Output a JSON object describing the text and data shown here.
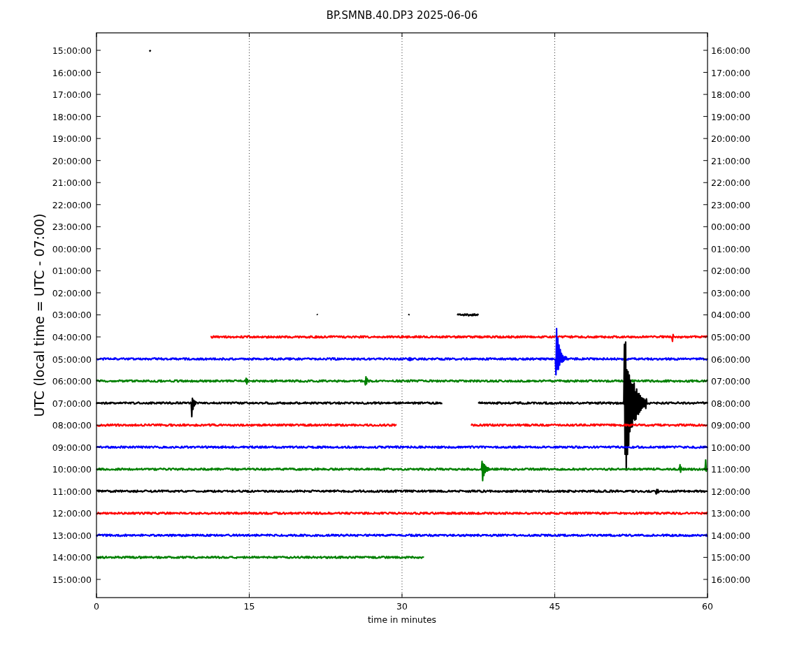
{
  "title": "BP.SMNB.40.DP3 2025-06-06",
  "ylabel": "UTC (local time = UTC - 07:00)",
  "xlabel": "time in minutes",
  "xticks": [
    "0",
    "15",
    "30",
    "45",
    "60"
  ],
  "rows": [
    {
      "left": "15:00:00",
      "right": "16:00:00",
      "color": "#000000"
    },
    {
      "left": "16:00:00",
      "right": "17:00:00"
    },
    {
      "left": "17:00:00",
      "right": "18:00:00"
    },
    {
      "left": "18:00:00",
      "right": "19:00:00"
    },
    {
      "left": "19:00:00",
      "right": "20:00:00"
    },
    {
      "left": "20:00:00",
      "right": "21:00:00"
    },
    {
      "left": "21:00:00",
      "right": "22:00:00"
    },
    {
      "left": "22:00:00",
      "right": "23:00:00"
    },
    {
      "left": "23:00:00",
      "right": "00:00:00"
    },
    {
      "left": "00:00:00",
      "right": "01:00:00"
    },
    {
      "left": "01:00:00",
      "right": "02:00:00"
    },
    {
      "left": "02:00:00",
      "right": "03:00:00"
    },
    {
      "left": "03:00:00",
      "right": "04:00:00",
      "color": "#000000"
    },
    {
      "left": "04:00:00",
      "right": "05:00:00",
      "color": "#ff0000"
    },
    {
      "left": "05:00:00",
      "right": "06:00:00",
      "color": "#0000ff"
    },
    {
      "left": "06:00:00",
      "right": "07:00:00",
      "color": "#008000"
    },
    {
      "left": "07:00:00",
      "right": "08:00:00",
      "color": "#000000"
    },
    {
      "left": "08:00:00",
      "right": "09:00:00",
      "color": "#ff0000"
    },
    {
      "left": "09:00:00",
      "right": "10:00:00",
      "color": "#0000ff"
    },
    {
      "left": "10:00:00",
      "right": "11:00:00",
      "color": "#008000"
    },
    {
      "left": "11:00:00",
      "right": "12:00:00",
      "color": "#000000"
    },
    {
      "left": "12:00:00",
      "right": "13:00:00",
      "color": "#ff0000"
    },
    {
      "left": "13:00:00",
      "right": "14:00:00",
      "color": "#0000ff"
    },
    {
      "left": "14:00:00",
      "right": "15:00:00",
      "color": "#008000"
    },
    {
      "left": "15:00:00",
      "right": "16:00:00"
    }
  ]
}
